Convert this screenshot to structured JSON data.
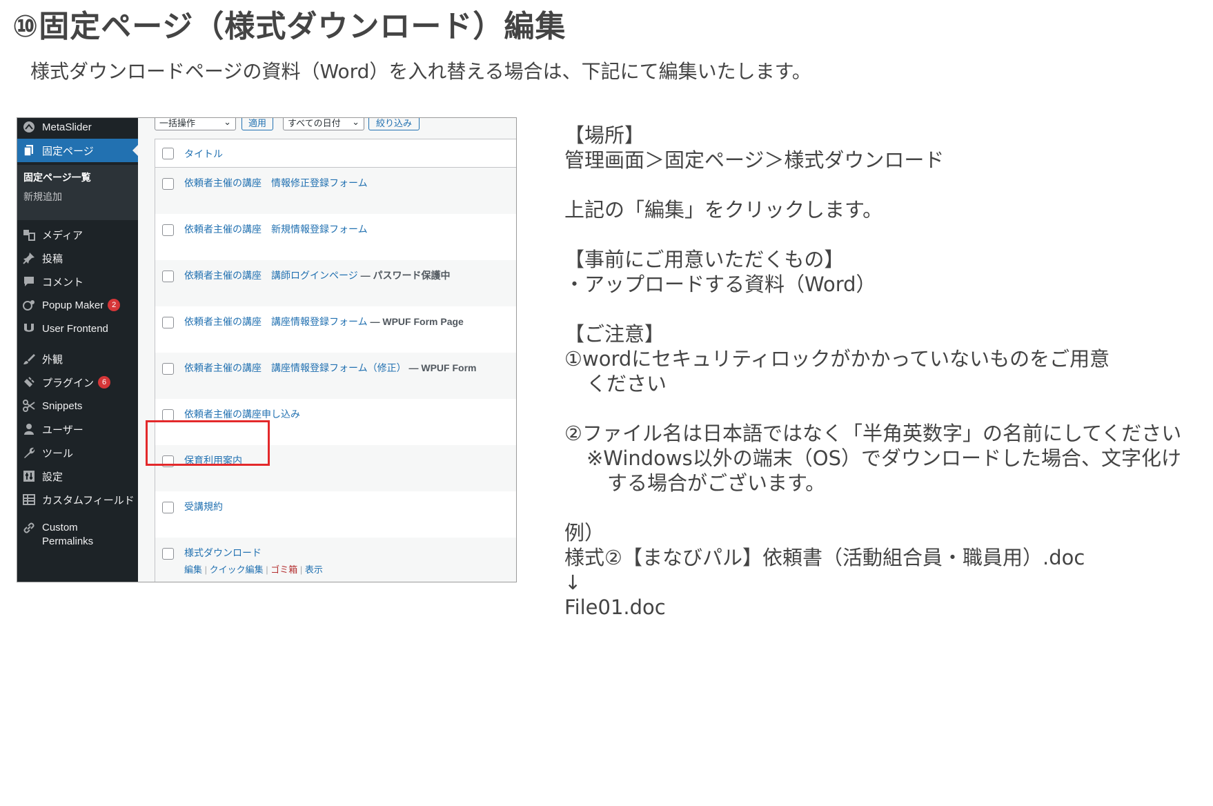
{
  "page": {
    "title": "⑩固定ページ（様式ダウンロード）編集",
    "subtitle": "様式ダウンロードページの資料（Word）を入れ替える場合は、下記にて編集いたします。"
  },
  "sidebar": {
    "top_item": "MetaSlider",
    "active_item": "固定ページ",
    "submenu": [
      "固定ページ一覧",
      "新規追加"
    ],
    "items": [
      {
        "label": "メディア",
        "icon": "media-icon"
      },
      {
        "label": "投稿",
        "icon": "pin-icon"
      },
      {
        "label": "コメント",
        "icon": "comment-icon"
      },
      {
        "label": "Popup Maker",
        "icon": "popup-icon",
        "badge": "2"
      },
      {
        "label": "User Frontend",
        "icon": "frontend-icon"
      },
      {
        "label": "外観",
        "icon": "brush-icon"
      },
      {
        "label": "プラグイン",
        "icon": "plugin-icon",
        "badge": "6"
      },
      {
        "label": "Snippets",
        "icon": "scissors-icon"
      },
      {
        "label": "ユーザー",
        "icon": "user-icon"
      },
      {
        "label": "ツール",
        "icon": "wrench-icon"
      },
      {
        "label": "設定",
        "icon": "settings-icon"
      },
      {
        "label": "カスタムフィールド",
        "icon": "grid-icon"
      },
      {
        "label": "Custom",
        "label2": "Permalinks",
        "icon": "link-icon"
      }
    ]
  },
  "toolbar": {
    "bulk_action": "一括操作",
    "apply": "適用",
    "date_filter": "すべての日付",
    "filter": "絞り込み"
  },
  "table": {
    "header": "タイトル",
    "rows": [
      {
        "title": "依頼者主催の講座　情報修正登録フォーム",
        "state": ""
      },
      {
        "title": "依頼者主催の講座　新規情報登録フォーム",
        "state": ""
      },
      {
        "title": "依頼者主催の講座　講師ログインページ",
        "state": " — パスワード保護中"
      },
      {
        "title": "依頼者主催の講座　講座情報登録フォーム",
        "state": " — WPUF Form Page"
      },
      {
        "title": "依頼者主催の講座　講座情報登録フォーム（修正）",
        "state": " — WPUF Form"
      },
      {
        "title": "依頼者主催の講座申し込み",
        "state": ""
      },
      {
        "title": "保育利用案内",
        "state": ""
      },
      {
        "title": "受講規約",
        "state": ""
      },
      {
        "title": "様式ダウンロード",
        "state": ""
      }
    ],
    "actions": {
      "edit": "編集",
      "quick_edit": "クイック編集",
      "trash": "ゴミ箱",
      "view": "表示"
    }
  },
  "info": {
    "lines": [
      "【場所】",
      "管理画面＞固定ページ＞様式ダウンロード",
      "",
      "上記の「編集」をクリックします。",
      "",
      "【事前にご用意いただくもの】",
      "・アップロードする資料（Word）",
      "",
      "【ご注意】",
      "①wordにセキュリティロックがかかっていないものをご用意",
      "ください",
      "",
      "②ファイル名は日本語ではなく「半角英数字」の名前にしてください",
      "※Windows以外の端末（OS）でダウンロードした場合、文字化け",
      "する場合がございます。",
      "",
      "例）",
      "様式②【まなびパル】依頼書（活動組合員・職員用）.doc",
      "↓",
      "File01.doc"
    ]
  },
  "colors": {
    "wp_blue": "#2271b1",
    "sidebar_bg": "#1d2327",
    "highlight": "#e3292b",
    "trash": "#b32d2e"
  }
}
